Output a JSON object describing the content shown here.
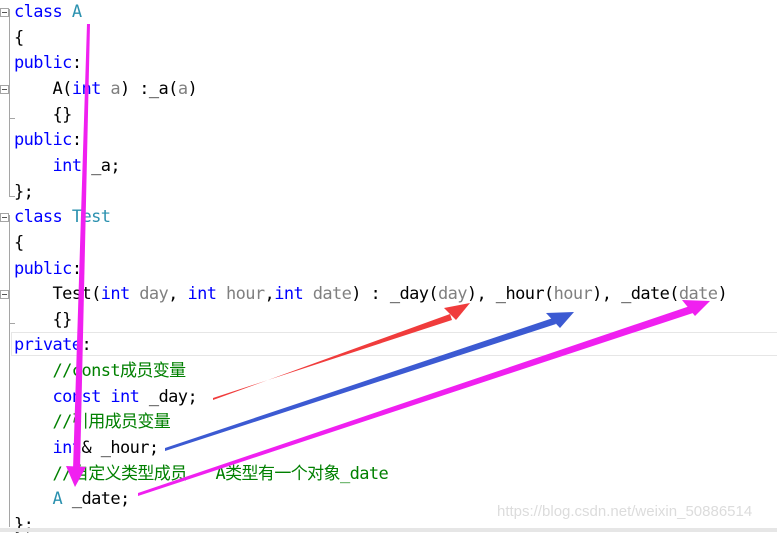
{
  "editor": {
    "lines": [
      [
        {
          "t": "class ",
          "c": "kw"
        },
        {
          "t": "A",
          "c": "ty"
        }
      ],
      [
        {
          "t": "{",
          "c": ""
        }
      ],
      [
        {
          "t": "public",
          "c": "kw"
        },
        {
          "t": ":",
          "c": ""
        }
      ],
      [
        {
          "t": "    A(",
          "c": ""
        },
        {
          "t": "int",
          "c": "kw"
        },
        {
          "t": " a",
          "c": "pa"
        },
        {
          "t": ") :_a(",
          "c": ""
        },
        {
          "t": "a",
          "c": "pa"
        },
        {
          "t": ")",
          "c": ""
        }
      ],
      [
        {
          "t": "    {}",
          "c": ""
        }
      ],
      [
        {
          "t": "public",
          "c": "kw"
        },
        {
          "t": ":",
          "c": ""
        }
      ],
      [
        {
          "t": "    ",
          "c": ""
        },
        {
          "t": "int",
          "c": "kw"
        },
        {
          "t": " _a;",
          "c": ""
        }
      ],
      [
        {
          "t": "};",
          "c": ""
        }
      ],
      [
        {
          "t": "class ",
          "c": "kw"
        },
        {
          "t": "Test",
          "c": "ty"
        }
      ],
      [
        {
          "t": "{",
          "c": ""
        }
      ],
      [
        {
          "t": "public",
          "c": "kw"
        },
        {
          "t": ":",
          "c": ""
        }
      ],
      [
        {
          "t": "    Test(",
          "c": ""
        },
        {
          "t": "int",
          "c": "kw"
        },
        {
          "t": " day",
          "c": "pa"
        },
        {
          "t": ", ",
          "c": ""
        },
        {
          "t": "int",
          "c": "kw"
        },
        {
          "t": " hour",
          "c": "pa"
        },
        {
          "t": ",",
          "c": ""
        },
        {
          "t": "int",
          "c": "kw"
        },
        {
          "t": " date",
          "c": "pa"
        },
        {
          "t": ") : _day(",
          "c": ""
        },
        {
          "t": "day",
          "c": "pa"
        },
        {
          "t": "), _hour(",
          "c": ""
        },
        {
          "t": "hour",
          "c": "pa"
        },
        {
          "t": "), _date(",
          "c": ""
        },
        {
          "t": "date",
          "c": "pa"
        },
        {
          "t": ")",
          "c": ""
        }
      ],
      [
        {
          "t": "    {}",
          "c": ""
        }
      ],
      [
        {
          "t": "private",
          "c": "kw"
        },
        {
          "t": ":",
          "c": ""
        }
      ],
      [
        {
          "t": "    //const成员变量",
          "c": "cm"
        }
      ],
      [
        {
          "t": "    ",
          "c": ""
        },
        {
          "t": "const int",
          "c": "kw"
        },
        {
          "t": " _day;",
          "c": ""
        }
      ],
      [
        {
          "t": "    //引用成员变量",
          "c": "cm"
        }
      ],
      [
        {
          "t": "    ",
          "c": ""
        },
        {
          "t": "int",
          "c": "kw"
        },
        {
          "t": "& _hour;",
          "c": ""
        }
      ],
      [
        {
          "t": "    //自定义类型成员   A类型有一个对象_date",
          "c": "cm"
        }
      ],
      [
        {
          "t": "    ",
          "c": ""
        },
        {
          "t": "A",
          "c": "ty"
        },
        {
          "t": " _date;",
          "c": ""
        }
      ],
      [
        {
          "t": "};",
          "c": ""
        }
      ]
    ],
    "fold_lines": [
      0,
      3,
      8,
      11
    ],
    "current_line": 13
  },
  "annotations": [
    {
      "name": "red-arrow",
      "color": "#f03c3c",
      "from": "_day declaration",
      "to": "_day(day) initializer"
    },
    {
      "name": "blue-arrow",
      "color": "#3c5ad2",
      "from": "_hour declaration",
      "to": "_hour(hour) initializer"
    },
    {
      "name": "magenta-arrow",
      "color": "#f020f0",
      "from": "_date declaration",
      "to": "_date(date) initializer"
    },
    {
      "name": "magenta-down-arrow",
      "color": "#f020f0",
      "from": "class A",
      "to": "A _date"
    }
  ],
  "watermark": "https://blog.csdn.net/weixin_50886514"
}
